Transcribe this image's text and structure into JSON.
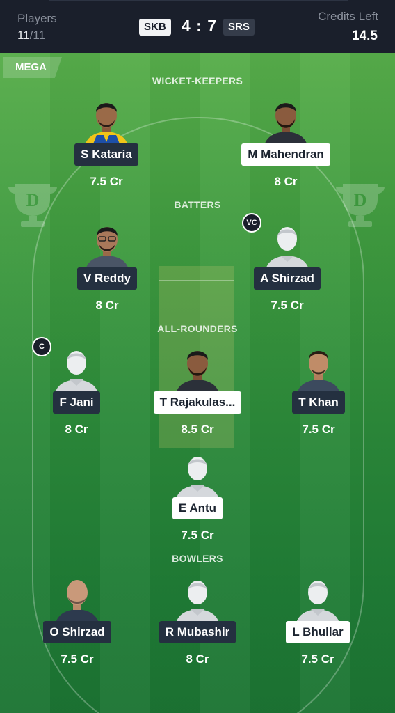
{
  "header": {
    "players_label": "Players",
    "players_selected": "11",
    "players_total": "/11",
    "team_a": "SKB",
    "score": "4 : 7",
    "team_b": "SRS",
    "credits_label": "Credits Left",
    "credits_value": "14.5"
  },
  "contest_tag": "MEGA",
  "colors": {
    "name_dark": "#243040",
    "name_light": "#ffffff",
    "field": "#2c8a3a"
  },
  "sections": {
    "wicket_keepers": "WICKET-KEEPERS",
    "batters": "BATTERS",
    "all_rounders": "ALL-ROUNDERS",
    "bowlers": "BOWLERS"
  },
  "badges": {
    "captain": "C",
    "vice_captain": "VC"
  },
  "players": [
    {
      "name": "S Kataria",
      "credit": "7.5 Cr",
      "team": "SKB",
      "avatar": "photo"
    },
    {
      "name": "M Mahendran",
      "credit": "8 Cr",
      "team": "SRS",
      "avatar": "photo"
    },
    {
      "name": "V Reddy",
      "credit": "8 Cr",
      "team": "SKB",
      "avatar": "photo"
    },
    {
      "name": "A Shirzad",
      "credit": "7.5 Cr",
      "team": "SKB",
      "avatar": "placeholder"
    },
    {
      "name": "F Jani",
      "credit": "8 Cr",
      "team": "SKB",
      "avatar": "placeholder"
    },
    {
      "name": "T Rajakulas...",
      "credit": "8.5 Cr",
      "team": "SRS",
      "avatar": "photo"
    },
    {
      "name": "T Khan",
      "credit": "7.5 Cr",
      "team": "SKB",
      "avatar": "photo"
    },
    {
      "name": "E Antu",
      "credit": "7.5 Cr",
      "team": "SRS",
      "avatar": "placeholder"
    },
    {
      "name": "O Shirzad",
      "credit": "7.5 Cr",
      "team": "SKB",
      "avatar": "photo"
    },
    {
      "name": "R Mubashir",
      "credit": "8 Cr",
      "team": "SKB",
      "avatar": "placeholder"
    },
    {
      "name": "L Bhullar",
      "credit": "7.5 Cr",
      "team": "SRS",
      "avatar": "placeholder"
    }
  ]
}
